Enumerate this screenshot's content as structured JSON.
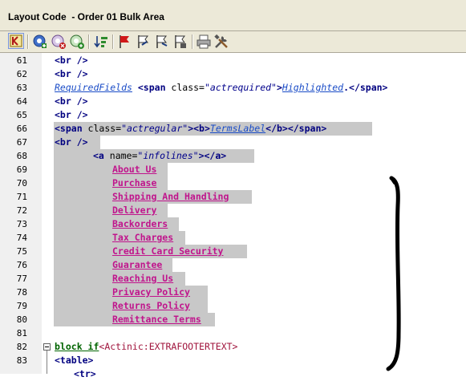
{
  "window": {
    "title": "Layout Code  - Order 01 Bulk Area"
  },
  "toolbar": {
    "buttons": [
      "collapse-icon",
      "insert-icon",
      "remove-icon",
      "add-icon",
      "sort-icon",
      "flag-icon",
      "flag-arrow-icon",
      "flag-back-icon",
      "flag-settings-icon",
      "print-icon",
      "tools-icon"
    ]
  },
  "lines": [
    {
      "n": "61"
    },
    {
      "n": "62"
    },
    {
      "n": "63"
    },
    {
      "n": "64"
    },
    {
      "n": "65"
    },
    {
      "n": "66"
    },
    {
      "n": "67"
    },
    {
      "n": "68"
    },
    {
      "n": "69"
    },
    {
      "n": "70"
    },
    {
      "n": "71"
    },
    {
      "n": "72"
    },
    {
      "n": "73"
    },
    {
      "n": "74"
    },
    {
      "n": "75"
    },
    {
      "n": "76"
    },
    {
      "n": "77"
    },
    {
      "n": "78"
    },
    {
      "n": "79"
    },
    {
      "n": "80"
    },
    {
      "n": "81"
    },
    {
      "n": "82"
    },
    {
      "n": "83"
    }
  ],
  "code": {
    "br": "<br />",
    "l63_placeholder": "RequiredFields",
    "l63_open": "<span",
    "l63_attr": " class=",
    "l63_val": "\"actrequired\"",
    "l63_close": ">",
    "l63_ph2": "Highlighted",
    "l63_end": ".</span>",
    "l66_open": "<span",
    "l66_attr": " class=",
    "l66_val": "\"actregular\"",
    "l66_b": "><b>",
    "l66_ph": "TermsLabel",
    "l66_end": "</b></span>",
    "l68_open": "<a",
    "l68_attr": " name=",
    "l68_val": "\"infolines\"",
    "l68_end": "></a>",
    "links": [
      "About Us",
      "Purchase",
      "Shipping And Handling",
      "Delivery",
      "Backorders",
      "Tax Charges",
      "Credit Card Security",
      "Guarantee",
      "Reaching Us",
      "Privacy Policy",
      "Returns Policy",
      "Remittance Terms"
    ],
    "l82_kw": "block if",
    "l82_act": "<Actinic:EXTRAFOOTERTEXT>",
    "l83": "<table>",
    "l84": "<tr>"
  }
}
